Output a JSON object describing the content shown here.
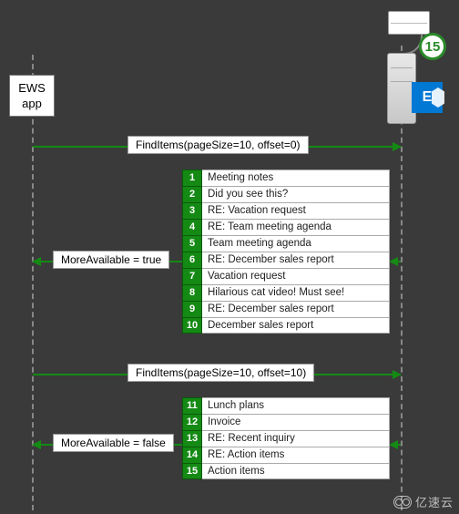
{
  "actors": {
    "client_label_l1": "EWS",
    "client_label_l2": "app",
    "server_logo_letter": "E",
    "mailbox_count": "15"
  },
  "calls": {
    "req1": "FindItems(pageSize=10, offset=0)",
    "resp1": "MoreAvailable = true",
    "req2": "FindItems(pageSize=10, offset=10)",
    "resp2": "MoreAvailable = false"
  },
  "page1": [
    {
      "n": "1",
      "subject": "Meeting notes"
    },
    {
      "n": "2",
      "subject": "Did you see this?"
    },
    {
      "n": "3",
      "subject": "RE: Vacation request"
    },
    {
      "n": "4",
      "subject": "RE: Team meeting agenda"
    },
    {
      "n": "5",
      "subject": "Team meeting agenda"
    },
    {
      "n": "6",
      "subject": "RE: December sales report"
    },
    {
      "n": "7",
      "subject": "Vacation request"
    },
    {
      "n": "8",
      "subject": "Hilarious cat video! Must see!"
    },
    {
      "n": "9",
      "subject": "RE: December sales report"
    },
    {
      "n": "10",
      "subject": "December sales report"
    }
  ],
  "page2": [
    {
      "n": "11",
      "subject": "Lunch plans"
    },
    {
      "n": "12",
      "subject": "Invoice"
    },
    {
      "n": "13",
      "subject": "RE: Recent inquiry"
    },
    {
      "n": "14",
      "subject": "RE: Action items"
    },
    {
      "n": "15",
      "subject": "Action items"
    }
  ],
  "watermark": "亿速云"
}
